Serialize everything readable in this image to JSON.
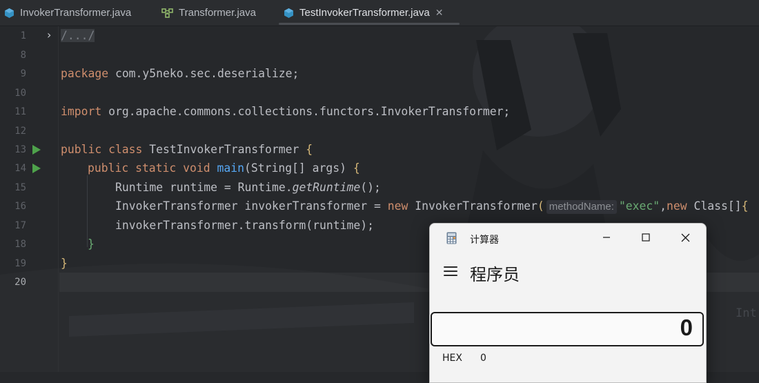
{
  "tabs": [
    {
      "label": "InvokerTransformer.java",
      "icon": "class-icon"
    },
    {
      "label": "Transformer.java",
      "icon": "interface-icon"
    },
    {
      "label": "TestInvokerTransformer.java",
      "icon": "class-icon",
      "active": true
    }
  ],
  "gutter": {
    "line_numbers": [
      "1",
      "8",
      "9",
      "10",
      "11",
      "12",
      "13",
      "14",
      "15",
      "16",
      "17",
      "18",
      "19",
      "20"
    ]
  },
  "code": {
    "fold_text": "/.../",
    "package_kw": "package",
    "package_name": " com.y5neko.sec.deserialize;",
    "import_kw": "import",
    "import_name": " org.apache.commons.collections.functors.InvokerTransformer;",
    "l13_kw": "public class",
    "l13_name": " TestInvokerTransformer ",
    "l13_brace": "{",
    "l14_kw": "public static void",
    "l14_method": "main",
    "l14_rest": "(String[] args) ",
    "l14_brace": "{",
    "l15_pre": "Runtime runtime = Runtime.",
    "l15_method": "getRuntime",
    "l15_post": "();",
    "l16_pre": "InvokerTransformer invokerTransformer = ",
    "l16_new": "new",
    "l16_mid": " InvokerTransformer",
    "l16_paren": "(",
    "l16_hint": "methodName:",
    "l16_str": "\"exec\"",
    "l16_comma": ",",
    "l16_new2": "new",
    "l16_tail": " Class[]",
    "l16_brace": "{",
    "l17": "invokerTransformer.transform(runtime);",
    "l18": "}",
    "l19": "}",
    "watermark": "Int"
  },
  "calculator": {
    "title": "计算器",
    "mode": "程序员",
    "display_value": "0",
    "hex_label": "HEX",
    "hex_value": "0"
  },
  "colors": {
    "keyword": "#cf8e6d",
    "method": "#56a8f5",
    "string": "#6aab73",
    "run_marker": "#4ea24b"
  }
}
